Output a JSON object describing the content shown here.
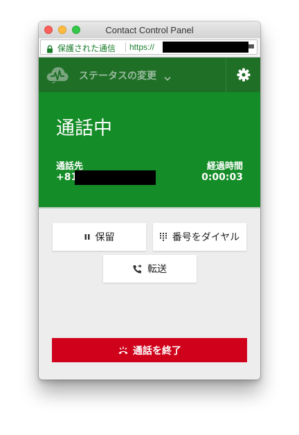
{
  "window": {
    "title": "Contact Control Panel"
  },
  "urlbar": {
    "secure_label": "保護された通信",
    "url_prefix": "https://"
  },
  "header": {
    "status_label": "ステータスの変更"
  },
  "call": {
    "status": "通話中",
    "destination_label": "通話先",
    "destination_number": "+81",
    "elapsed_label": "経過時間",
    "elapsed_time": "0:00:03"
  },
  "actions": {
    "hold_label": "保留",
    "dial_label": "番号をダイヤル",
    "transfer_label": "転送",
    "end_call_label": "通話を終了"
  },
  "colors": {
    "header_bg": "#1f6f27",
    "call_bg": "#148c27",
    "end_button": "#d0021b",
    "panel_bg": "#ededed"
  }
}
